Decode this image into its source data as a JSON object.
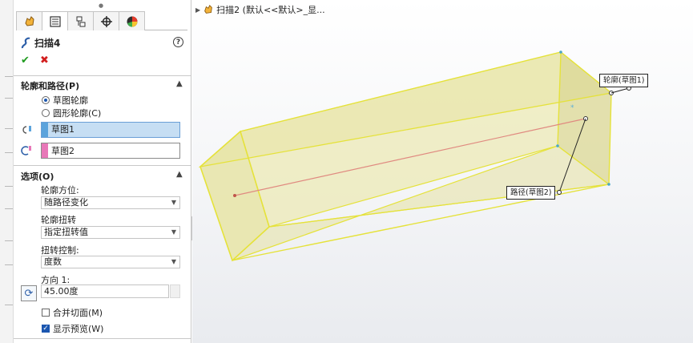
{
  "feature_manager": {
    "tabs": [
      {
        "name": "feature-manager-tab",
        "icon": "feature-tree-icon"
      },
      {
        "name": "property-manager-tab",
        "icon": "property-sheet-icon"
      },
      {
        "name": "configuration-manager-tab",
        "icon": "configuration-icon"
      },
      {
        "name": "dimxpert-tab",
        "icon": "crosshair-icon"
      },
      {
        "name": "display-manager-tab",
        "icon": "appearance-pie-icon"
      }
    ]
  },
  "property_manager": {
    "title": "扫描4",
    "help": "?",
    "ok": "✔",
    "cancel": "✖",
    "profile_path": {
      "header": "轮廓和路径(P)",
      "radio_sketch_profile": "草图轮廓",
      "radio_circular_profile": "圆形轮廓(C)",
      "profile_value": "草图1",
      "path_value": "草图2",
      "profile_color": "#5ba3dc",
      "path_color": "#e878b8"
    },
    "options": {
      "header": "选项(O)",
      "orientation_label": "轮廓方位:",
      "orientation_value": "随路径变化",
      "twist_label": "轮廓扭转",
      "twist_value": "指定扭转值",
      "twist_control_label": "扭转控制:",
      "twist_control_value": "度数",
      "direction_label": "方向 1:",
      "angle_value": "45.00度",
      "merge_tangent_label": "合并切面(M)",
      "merge_tangent_checked": false,
      "show_preview_label": "显示预览(W)",
      "show_preview_checked": true
    }
  },
  "viewport": {
    "breadcrumb": "扫描2 (默认<<默认>_显...",
    "callout_profile": "轮廓(草图1)",
    "callout_path": "路径(草图2)",
    "preview_fill": "#e9e6a6",
    "preview_edge": "#e5e23a",
    "path_line_color": "#e08a80"
  }
}
